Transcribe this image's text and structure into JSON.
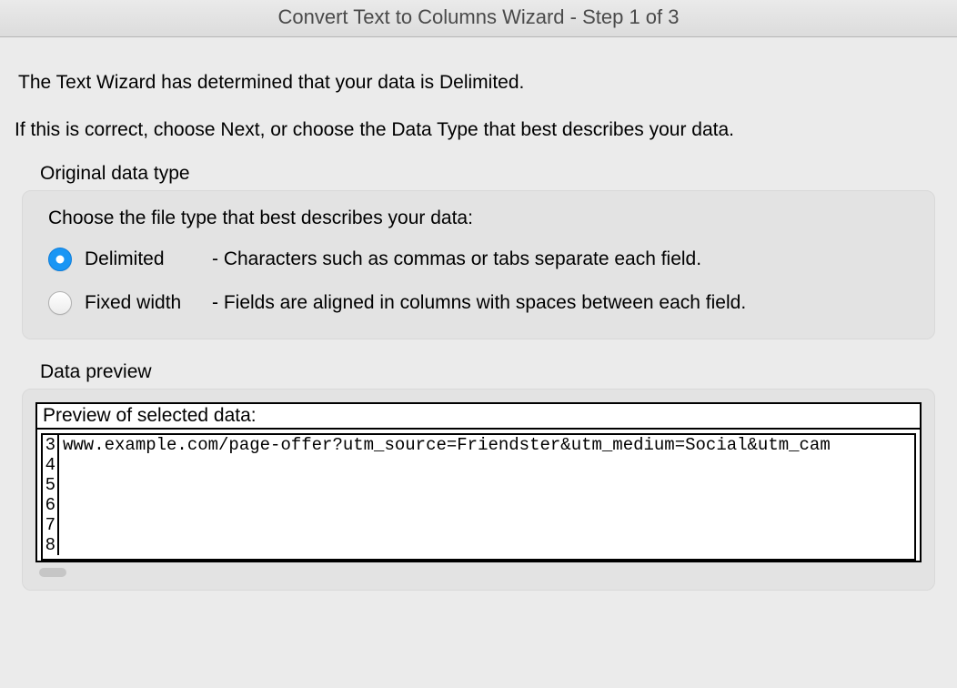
{
  "title": "Convert Text to Columns Wizard - Step 1 of 3",
  "intro_line_1": "The Text Wizard has determined that your data is Delimited.",
  "intro_line_2": "If this is correct, choose Next, or choose the Data Type that best describes your data.",
  "original_data_type": {
    "section_label": "Original data type",
    "prompt": "Choose the file type that best describes your data:",
    "options": [
      {
        "id": "delimited",
        "label": "Delimited",
        "description": "- Characters such as commas or tabs separate each field.",
        "selected": true
      },
      {
        "id": "fixed-width",
        "label": "Fixed width",
        "description": "- Fields are aligned in columns with spaces between each field.",
        "selected": false
      }
    ]
  },
  "data_preview": {
    "section_label": "Data preview",
    "header": "Preview of selected data:",
    "rows": [
      {
        "num": "3",
        "text": "www.example.com/page-offer?utm_source=Friendster&utm_medium=Social&utm_cam"
      },
      {
        "num": "4",
        "text": ""
      },
      {
        "num": "5",
        "text": ""
      },
      {
        "num": "6",
        "text": ""
      },
      {
        "num": "7",
        "text": ""
      },
      {
        "num": "8",
        "text": ""
      }
    ]
  }
}
